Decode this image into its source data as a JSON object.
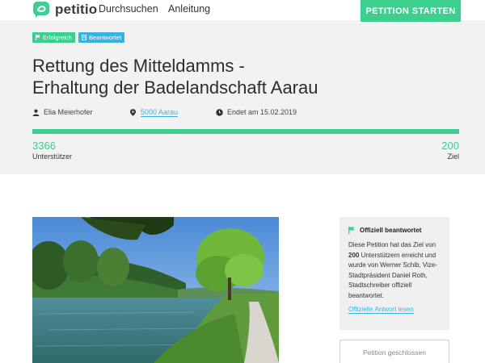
{
  "header": {
    "logo_text": "petitio",
    "nav": [
      {
        "label": "Durchsuchen"
      },
      {
        "label": "Anleitung"
      }
    ],
    "cta_label": "PETITION STARTEN"
  },
  "petition": {
    "badges": [
      {
        "label": "Erfolgreich",
        "color": "#3ccf8e"
      },
      {
        "label": "Beantwortet",
        "color": "#38b3df"
      }
    ],
    "title_line1": "Rettung des Mitteldamms -",
    "title_line2": "Erhaltung der Badelandschaft Aarau",
    "author": "Elia Meierhofer",
    "location": "5000 Aarau",
    "end_date": "Endet am 15.02.2019",
    "supporters": "3366",
    "supporters_label": "Unterstützer",
    "goal": "200",
    "goal_label": "Ziel",
    "progress_fraction": 1.0
  },
  "sidebar": {
    "heading": "Offiziell beantwortet",
    "text_before": "Diese Petition hat das Ziel von ",
    "text_goal": "200",
    "text_after": " Unterstützern erreicht und wurde von Werner Schib, Vize-Stadtpräsident Daniel Roth, Stadtschreiber offiziell beantwortet.",
    "link": "Offizielle Antwort lesen",
    "closed_button": "Petition geschlossen"
  },
  "icons": {
    "logo": "petitio-logo-icon",
    "flag": "flag-icon",
    "answer": "document-icon",
    "user": "user-icon",
    "location": "location-pin-icon",
    "clock": "clock-icon"
  },
  "colors": {
    "accent": "#3ccf8e",
    "link": "#38b3df"
  }
}
